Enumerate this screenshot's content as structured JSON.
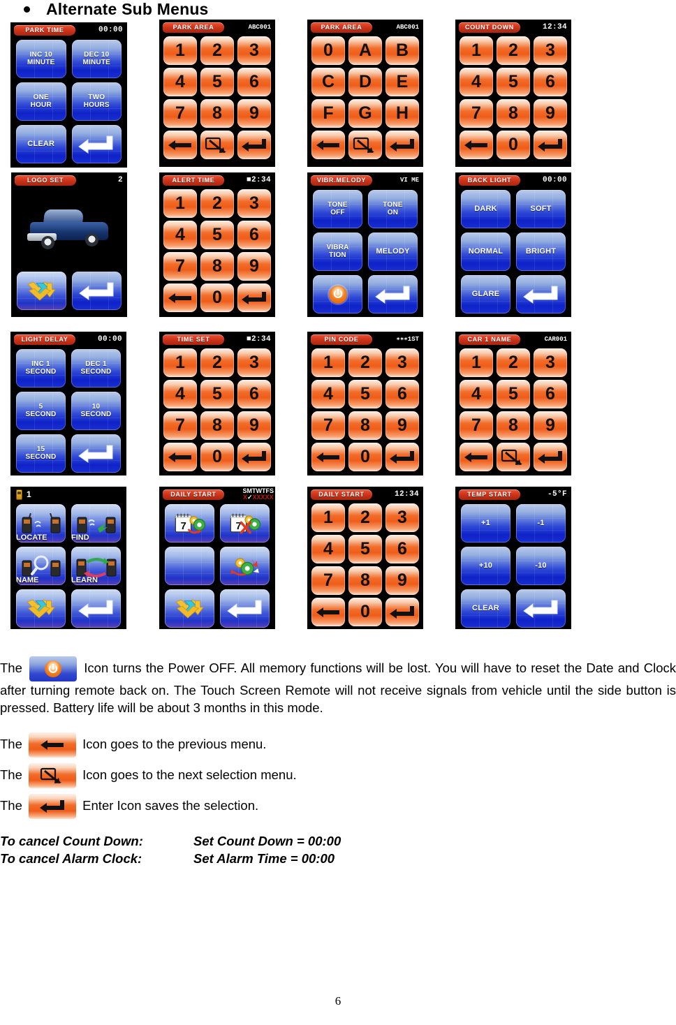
{
  "heading": {
    "bullet": "•",
    "title": "Alternate Sub Menus"
  },
  "screens": [
    {
      "id": "park-time",
      "title": "PARK TIME",
      "value": "00:00",
      "type": "duo",
      "keys": [
        {
          "label": "INC 10\nMINUTE",
          "style": "blue"
        },
        {
          "label": "DEC 10\nMINUTE",
          "style": "blue"
        },
        {
          "label": "ONE\nHOUR",
          "style": "blue"
        },
        {
          "label": "TWO\nHOURS",
          "style": "blue"
        },
        {
          "label": "CLEAR",
          "style": "blue"
        },
        {
          "label": "",
          "style": "blue",
          "icon": "enter-icon-white"
        }
      ]
    },
    {
      "id": "park-area-digits",
      "title": "PARK AREA",
      "value": "ABC001",
      "type": "num",
      "keys": [
        {
          "label": "1"
        },
        {
          "label": "2"
        },
        {
          "label": "3"
        },
        {
          "label": "4"
        },
        {
          "label": "5"
        },
        {
          "label": "6"
        },
        {
          "label": "7"
        },
        {
          "label": "8"
        },
        {
          "label": "9"
        },
        {
          "label": "",
          "icon": "back-arrow-icon"
        },
        {
          "label": "",
          "icon": "next-selection-icon"
        },
        {
          "label": "",
          "icon": "enter-icon"
        }
      ]
    },
    {
      "id": "park-area-letters",
      "title": "PARK AREA",
      "value": "ABC001",
      "type": "num",
      "keys": [
        {
          "label": "0"
        },
        {
          "label": "A"
        },
        {
          "label": "B"
        },
        {
          "label": "C"
        },
        {
          "label": "D"
        },
        {
          "label": "E"
        },
        {
          "label": "F"
        },
        {
          "label": "G"
        },
        {
          "label": "H"
        },
        {
          "label": "",
          "icon": "back-arrow-icon"
        },
        {
          "label": "",
          "icon": "next-selection-icon"
        },
        {
          "label": "",
          "icon": "enter-icon"
        }
      ]
    },
    {
      "id": "count-down",
      "title": "COUNT DOWN",
      "value": "12:34",
      "type": "num",
      "keys": [
        {
          "label": "1"
        },
        {
          "label": "2"
        },
        {
          "label": "3"
        },
        {
          "label": "4"
        },
        {
          "label": "5"
        },
        {
          "label": "6"
        },
        {
          "label": "7"
        },
        {
          "label": "8"
        },
        {
          "label": "9"
        },
        {
          "label": "",
          "icon": "back-arrow-icon"
        },
        {
          "label": "0"
        },
        {
          "label": "",
          "icon": "enter-icon"
        }
      ]
    },
    {
      "id": "logo-set",
      "title": "LOGO SET",
      "value": "2",
      "type": "logo",
      "keys": [
        {
          "label": "",
          "style": "lightblue",
          "icon": "page-down-icon"
        },
        {
          "label": "",
          "style": "blue",
          "icon": "enter-icon-white"
        }
      ]
    },
    {
      "id": "alert-time",
      "title": "ALERT TIME",
      "value": "■2:34",
      "type": "num",
      "keys": [
        {
          "label": "1"
        },
        {
          "label": "2"
        },
        {
          "label": "3"
        },
        {
          "label": "4"
        },
        {
          "label": "5"
        },
        {
          "label": "6"
        },
        {
          "label": "7"
        },
        {
          "label": "8"
        },
        {
          "label": "9"
        },
        {
          "label": "",
          "icon": "back-arrow-icon"
        },
        {
          "label": "0"
        },
        {
          "label": "",
          "icon": "enter-icon"
        }
      ]
    },
    {
      "id": "vibr-melody",
      "title": "VIBR.MELODY",
      "value": "VI  ME",
      "type": "duo",
      "keys": [
        {
          "label": "TONE\nOFF",
          "style": "blue"
        },
        {
          "label": "TONE\nON",
          "style": "blue"
        },
        {
          "label": "VIBRA\nTION",
          "style": "blue"
        },
        {
          "label": "MELODY",
          "style": "blue"
        },
        {
          "label": "",
          "style": "blue",
          "icon": "power-icon"
        },
        {
          "label": "",
          "style": "blue",
          "icon": "enter-icon-white"
        }
      ]
    },
    {
      "id": "back-light",
      "title": "BACK LIGHT",
      "value": "00:00",
      "type": "duo",
      "keys": [
        {
          "label": "DARK",
          "style": "blue"
        },
        {
          "label": "SOFT",
          "style": "blue"
        },
        {
          "label": "NORMAL",
          "style": "blue"
        },
        {
          "label": "BRIGHT",
          "style": "blue"
        },
        {
          "label": "GLARE",
          "style": "blue"
        },
        {
          "label": "",
          "style": "blue",
          "icon": "enter-icon-white"
        }
      ]
    },
    {
      "id": "light-delay",
      "title": "LIGHT DELAY",
      "value": "00:00",
      "type": "duo",
      "keys": [
        {
          "label": "INC 1\nSECOND",
          "style": "blue"
        },
        {
          "label": "DEC 1\nSECOND",
          "style": "blue"
        },
        {
          "label": "5\nSECOND",
          "style": "blue"
        },
        {
          "label": "10\nSECOND",
          "style": "blue"
        },
        {
          "label": "15\nSECOND",
          "style": "blue"
        },
        {
          "label": "",
          "style": "blue",
          "icon": "enter-icon-white"
        }
      ]
    },
    {
      "id": "time-set",
      "title": "TIME SET",
      "value": "■2:34",
      "type": "num",
      "keys": [
        {
          "label": "1"
        },
        {
          "label": "2"
        },
        {
          "label": "3"
        },
        {
          "label": "4"
        },
        {
          "label": "5"
        },
        {
          "label": "6"
        },
        {
          "label": "7"
        },
        {
          "label": "8"
        },
        {
          "label": "9"
        },
        {
          "label": "",
          "icon": "back-arrow-icon"
        },
        {
          "label": "0"
        },
        {
          "label": "",
          "icon": "enter-icon"
        }
      ]
    },
    {
      "id": "pin-code",
      "title": "PIN CODE",
      "value": "∗∗∗1ST",
      "type": "num",
      "keys": [
        {
          "label": "1"
        },
        {
          "label": "2"
        },
        {
          "label": "3"
        },
        {
          "label": "4"
        },
        {
          "label": "5"
        },
        {
          "label": "6"
        },
        {
          "label": "7"
        },
        {
          "label": "8"
        },
        {
          "label": "9"
        },
        {
          "label": "",
          "icon": "back-arrow-icon"
        },
        {
          "label": "0"
        },
        {
          "label": "",
          "icon": "enter-icon"
        }
      ]
    },
    {
      "id": "car-1-name",
      "title": "CAR 1 NAME",
      "value": "CAR001",
      "type": "num",
      "keys": [
        {
          "label": "1"
        },
        {
          "label": "2"
        },
        {
          "label": "3"
        },
        {
          "label": "4"
        },
        {
          "label": "5"
        },
        {
          "label": "6"
        },
        {
          "label": "7"
        },
        {
          "label": "8"
        },
        {
          "label": "9"
        },
        {
          "label": "",
          "icon": "back-arrow-icon"
        },
        {
          "label": "",
          "icon": "next-selection-icon"
        },
        {
          "label": "",
          "icon": "enter-icon"
        }
      ]
    },
    {
      "id": "unit-menu",
      "title": "",
      "value": "1",
      "type": "unit",
      "keys": [
        {
          "label": "LOCATE",
          "style": "lightblue",
          "icon": "locate-icon"
        },
        {
          "label": "FIND",
          "style": "lightblue",
          "icon": "find-icon"
        },
        {
          "label": "NAME",
          "style": "lightblue",
          "icon": "name-icon"
        },
        {
          "label": "LEARN",
          "style": "lightblue",
          "icon": "learn-icon"
        },
        {
          "label": "",
          "style": "lightblue",
          "icon": "page-down-icon"
        },
        {
          "label": "",
          "style": "lightblue",
          "icon": "enter-icon-white"
        }
      ]
    },
    {
      "id": "daily-start-days",
      "title": "DAILY START",
      "value": "SMTWTFS",
      "days_letters": "SMTWTFS",
      "days_marks": "X✓XXXXX",
      "type": "duo",
      "keys": [
        {
          "label": "",
          "style": "lightblue",
          "icon": "calendar-set-icon"
        },
        {
          "label": "",
          "style": "lightblue",
          "icon": "calendar-cancel-icon"
        },
        {
          "label": "",
          "style": "lightblue"
        },
        {
          "label": "",
          "style": "lightblue",
          "icon": "gears-icon"
        },
        {
          "label": "",
          "style": "lightblue",
          "icon": "page-down-icon"
        },
        {
          "label": "",
          "style": "lightblue",
          "icon": "enter-icon-white"
        }
      ]
    },
    {
      "id": "daily-start-time",
      "title": "DAILY START",
      "value": "12:34",
      "type": "num",
      "keys": [
        {
          "label": "1"
        },
        {
          "label": "2"
        },
        {
          "label": "3"
        },
        {
          "label": "4"
        },
        {
          "label": "5"
        },
        {
          "label": "6"
        },
        {
          "label": "7"
        },
        {
          "label": "8"
        },
        {
          "label": "9"
        },
        {
          "label": "",
          "icon": "back-arrow-icon"
        },
        {
          "label": "0"
        },
        {
          "label": "",
          "icon": "enter-icon"
        }
      ]
    },
    {
      "id": "temp-start",
      "title": "TEMP START",
      "value": "-5°F",
      "type": "duo",
      "keys": [
        {
          "label": "+1",
          "style": "blue"
        },
        {
          "label": "-1",
          "style": "blue"
        },
        {
          "label": "+10",
          "style": "blue"
        },
        {
          "label": "-10",
          "style": "blue"
        },
        {
          "label": "CLEAR",
          "style": "blue"
        },
        {
          "label": "",
          "style": "blue",
          "icon": "enter-icon-white"
        }
      ]
    }
  ],
  "body": {
    "power_para_pre": "The",
    "power_para_post": "Icon turns the Power OFF. All memory functions will be lost. You will have to reset the Date and Clock after turning remote back on. The Touch Screen Remote will not receive signals from vehicle until the side button is pressed. Battery life will be about 3 months in this mode.",
    "lines": [
      {
        "pre": "The",
        "icon": "back-arrow-icon",
        "post": "Icon goes to the previous menu."
      },
      {
        "pre": "The",
        "icon": "next-selection-icon",
        "post": "Icon goes to the next selection menu."
      },
      {
        "pre": "The",
        "icon": "enter-icon",
        "post": "Enter Icon saves the selection."
      }
    ],
    "cancel": [
      {
        "label": "To cancel Count Down:",
        "value": "Set Count Down = 00:00"
      },
      {
        "label": "To cancel Alarm Clock:",
        "value": "Set Alarm Time = 00:00"
      }
    ]
  },
  "footer": {
    "page_number": "6"
  },
  "colors": {
    "screen_bg": "#000000",
    "title_pill": "#d2361b",
    "orange_key": "#f26c2a",
    "blue_key": "#1f34cc",
    "text": "#000000"
  }
}
